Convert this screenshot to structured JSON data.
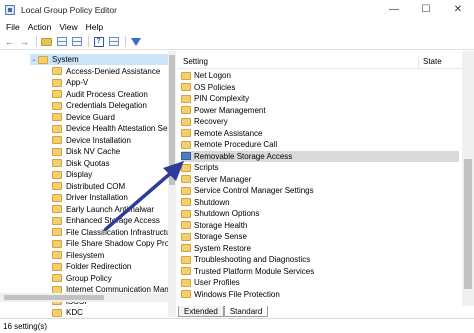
{
  "window": {
    "title": "Local Group Policy Editor",
    "minimize": "—",
    "maximize": "☐",
    "close": "✕"
  },
  "menu": [
    "File",
    "Action",
    "View",
    "Help"
  ],
  "toolbar": {
    "back": "←",
    "forward": "→"
  },
  "tree": {
    "items": [
      {
        "label": "System",
        "expand": "⌄",
        "selected": true
      },
      {
        "label": "Access-Denied Assistance"
      },
      {
        "label": "App-V"
      },
      {
        "label": "Audit Process Creation"
      },
      {
        "label": "Credentials Delegation"
      },
      {
        "label": "Device Guard"
      },
      {
        "label": "Device Health Attestation Servi"
      },
      {
        "label": "Device Installation"
      },
      {
        "label": "Disk NV Cache"
      },
      {
        "label": "Disk Quotas"
      },
      {
        "label": "Display"
      },
      {
        "label": "Distributed COM"
      },
      {
        "label": "Driver Installation"
      },
      {
        "label": "Early Launch Antimalwar"
      },
      {
        "label": "Enhanced Storage Access"
      },
      {
        "label": "File Classification Infrastructur"
      },
      {
        "label": "File Share Shadow Copy Provid"
      },
      {
        "label": "Filesystem"
      },
      {
        "label": "Folder Redirection"
      },
      {
        "label": "Group Policy"
      },
      {
        "label": "Internet Communication Mana"
      },
      {
        "label": "iSCSI"
      },
      {
        "label": "KDC"
      }
    ]
  },
  "list": {
    "columns": {
      "setting": "Setting",
      "state": "State"
    },
    "rows": [
      {
        "label": "Net Logon",
        "type": "folder"
      },
      {
        "label": "OS Policies",
        "type": "folder"
      },
      {
        "label": "PIN Complexity",
        "type": "folder"
      },
      {
        "label": "Power Management",
        "type": "folder"
      },
      {
        "label": "Recovery",
        "type": "folder"
      },
      {
        "label": "Remote Assistance",
        "type": "folder"
      },
      {
        "label": "Remote Procedure Call",
        "type": "folder"
      },
      {
        "label": "Removable Storage Access",
        "type": "policy",
        "selected": true
      },
      {
        "label": "Scripts",
        "type": "folder"
      },
      {
        "label": "Server Manager",
        "type": "folder"
      },
      {
        "label": "Service Control Manager Settings",
        "type": "folder"
      },
      {
        "label": "Shutdown",
        "type": "folder"
      },
      {
        "label": "Shutdown Options",
        "type": "folder"
      },
      {
        "label": "Storage Health",
        "type": "folder"
      },
      {
        "label": "Storage Sense",
        "type": "folder"
      },
      {
        "label": "System Restore",
        "type": "folder"
      },
      {
        "label": "Troubleshooting and Diagnostics",
        "type": "folder"
      },
      {
        "label": "Trusted Platform Module Services",
        "type": "folder"
      },
      {
        "label": "User Profiles",
        "type": "folder"
      },
      {
        "label": "Windows File Protection",
        "type": "folder"
      }
    ]
  },
  "tabs": [
    "Extended",
    "Standard"
  ],
  "status": "16 setting(s)",
  "colors": {
    "arrow": "#2f3a9a",
    "selection": "#d9d9d9",
    "tree_selection": "#cce4f7"
  }
}
